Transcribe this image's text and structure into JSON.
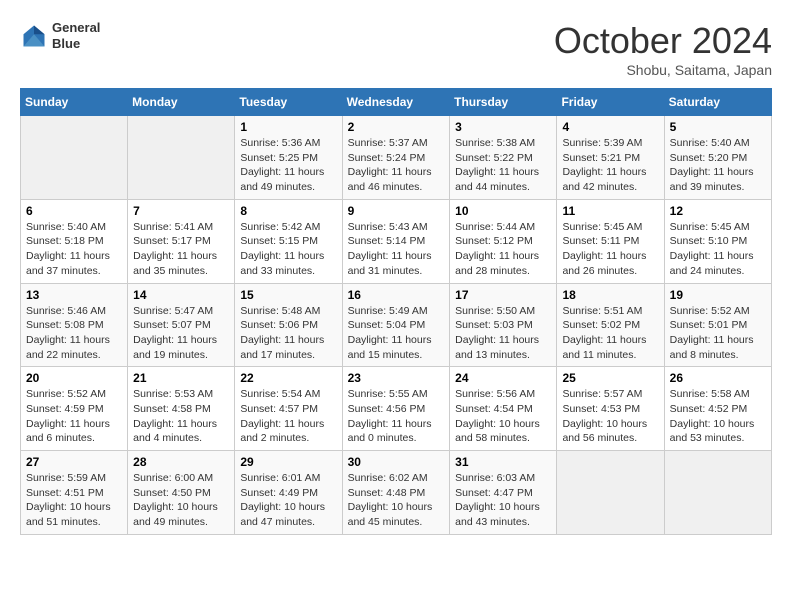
{
  "header": {
    "logo_line1": "General",
    "logo_line2": "Blue",
    "month": "October 2024",
    "location": "Shobu, Saitama, Japan"
  },
  "weekdays": [
    "Sunday",
    "Monday",
    "Tuesday",
    "Wednesday",
    "Thursday",
    "Friday",
    "Saturday"
  ],
  "weeks": [
    [
      {
        "day": "",
        "sunrise": "",
        "sunset": "",
        "daylight": ""
      },
      {
        "day": "",
        "sunrise": "",
        "sunset": "",
        "daylight": ""
      },
      {
        "day": "1",
        "sunrise": "Sunrise: 5:36 AM",
        "sunset": "Sunset: 5:25 PM",
        "daylight": "Daylight: 11 hours and 49 minutes."
      },
      {
        "day": "2",
        "sunrise": "Sunrise: 5:37 AM",
        "sunset": "Sunset: 5:24 PM",
        "daylight": "Daylight: 11 hours and 46 minutes."
      },
      {
        "day": "3",
        "sunrise": "Sunrise: 5:38 AM",
        "sunset": "Sunset: 5:22 PM",
        "daylight": "Daylight: 11 hours and 44 minutes."
      },
      {
        "day": "4",
        "sunrise": "Sunrise: 5:39 AM",
        "sunset": "Sunset: 5:21 PM",
        "daylight": "Daylight: 11 hours and 42 minutes."
      },
      {
        "day": "5",
        "sunrise": "Sunrise: 5:40 AM",
        "sunset": "Sunset: 5:20 PM",
        "daylight": "Daylight: 11 hours and 39 minutes."
      }
    ],
    [
      {
        "day": "6",
        "sunrise": "Sunrise: 5:40 AM",
        "sunset": "Sunset: 5:18 PM",
        "daylight": "Daylight: 11 hours and 37 minutes."
      },
      {
        "day": "7",
        "sunrise": "Sunrise: 5:41 AM",
        "sunset": "Sunset: 5:17 PM",
        "daylight": "Daylight: 11 hours and 35 minutes."
      },
      {
        "day": "8",
        "sunrise": "Sunrise: 5:42 AM",
        "sunset": "Sunset: 5:15 PM",
        "daylight": "Daylight: 11 hours and 33 minutes."
      },
      {
        "day": "9",
        "sunrise": "Sunrise: 5:43 AM",
        "sunset": "Sunset: 5:14 PM",
        "daylight": "Daylight: 11 hours and 31 minutes."
      },
      {
        "day": "10",
        "sunrise": "Sunrise: 5:44 AM",
        "sunset": "Sunset: 5:12 PM",
        "daylight": "Daylight: 11 hours and 28 minutes."
      },
      {
        "day": "11",
        "sunrise": "Sunrise: 5:45 AM",
        "sunset": "Sunset: 5:11 PM",
        "daylight": "Daylight: 11 hours and 26 minutes."
      },
      {
        "day": "12",
        "sunrise": "Sunrise: 5:45 AM",
        "sunset": "Sunset: 5:10 PM",
        "daylight": "Daylight: 11 hours and 24 minutes."
      }
    ],
    [
      {
        "day": "13",
        "sunrise": "Sunrise: 5:46 AM",
        "sunset": "Sunset: 5:08 PM",
        "daylight": "Daylight: 11 hours and 22 minutes."
      },
      {
        "day": "14",
        "sunrise": "Sunrise: 5:47 AM",
        "sunset": "Sunset: 5:07 PM",
        "daylight": "Daylight: 11 hours and 19 minutes."
      },
      {
        "day": "15",
        "sunrise": "Sunrise: 5:48 AM",
        "sunset": "Sunset: 5:06 PM",
        "daylight": "Daylight: 11 hours and 17 minutes."
      },
      {
        "day": "16",
        "sunrise": "Sunrise: 5:49 AM",
        "sunset": "Sunset: 5:04 PM",
        "daylight": "Daylight: 11 hours and 15 minutes."
      },
      {
        "day": "17",
        "sunrise": "Sunrise: 5:50 AM",
        "sunset": "Sunset: 5:03 PM",
        "daylight": "Daylight: 11 hours and 13 minutes."
      },
      {
        "day": "18",
        "sunrise": "Sunrise: 5:51 AM",
        "sunset": "Sunset: 5:02 PM",
        "daylight": "Daylight: 11 hours and 11 minutes."
      },
      {
        "day": "19",
        "sunrise": "Sunrise: 5:52 AM",
        "sunset": "Sunset: 5:01 PM",
        "daylight": "Daylight: 11 hours and 8 minutes."
      }
    ],
    [
      {
        "day": "20",
        "sunrise": "Sunrise: 5:52 AM",
        "sunset": "Sunset: 4:59 PM",
        "daylight": "Daylight: 11 hours and 6 minutes."
      },
      {
        "day": "21",
        "sunrise": "Sunrise: 5:53 AM",
        "sunset": "Sunset: 4:58 PM",
        "daylight": "Daylight: 11 hours and 4 minutes."
      },
      {
        "day": "22",
        "sunrise": "Sunrise: 5:54 AM",
        "sunset": "Sunset: 4:57 PM",
        "daylight": "Daylight: 11 hours and 2 minutes."
      },
      {
        "day": "23",
        "sunrise": "Sunrise: 5:55 AM",
        "sunset": "Sunset: 4:56 PM",
        "daylight": "Daylight: 11 hours and 0 minutes."
      },
      {
        "day": "24",
        "sunrise": "Sunrise: 5:56 AM",
        "sunset": "Sunset: 4:54 PM",
        "daylight": "Daylight: 10 hours and 58 minutes."
      },
      {
        "day": "25",
        "sunrise": "Sunrise: 5:57 AM",
        "sunset": "Sunset: 4:53 PM",
        "daylight": "Daylight: 10 hours and 56 minutes."
      },
      {
        "day": "26",
        "sunrise": "Sunrise: 5:58 AM",
        "sunset": "Sunset: 4:52 PM",
        "daylight": "Daylight: 10 hours and 53 minutes."
      }
    ],
    [
      {
        "day": "27",
        "sunrise": "Sunrise: 5:59 AM",
        "sunset": "Sunset: 4:51 PM",
        "daylight": "Daylight: 10 hours and 51 minutes."
      },
      {
        "day": "28",
        "sunrise": "Sunrise: 6:00 AM",
        "sunset": "Sunset: 4:50 PM",
        "daylight": "Daylight: 10 hours and 49 minutes."
      },
      {
        "day": "29",
        "sunrise": "Sunrise: 6:01 AM",
        "sunset": "Sunset: 4:49 PM",
        "daylight": "Daylight: 10 hours and 47 minutes."
      },
      {
        "day": "30",
        "sunrise": "Sunrise: 6:02 AM",
        "sunset": "Sunset: 4:48 PM",
        "daylight": "Daylight: 10 hours and 45 minutes."
      },
      {
        "day": "31",
        "sunrise": "Sunrise: 6:03 AM",
        "sunset": "Sunset: 4:47 PM",
        "daylight": "Daylight: 10 hours and 43 minutes."
      },
      {
        "day": "",
        "sunrise": "",
        "sunset": "",
        "daylight": ""
      },
      {
        "day": "",
        "sunrise": "",
        "sunset": "",
        "daylight": ""
      }
    ]
  ]
}
